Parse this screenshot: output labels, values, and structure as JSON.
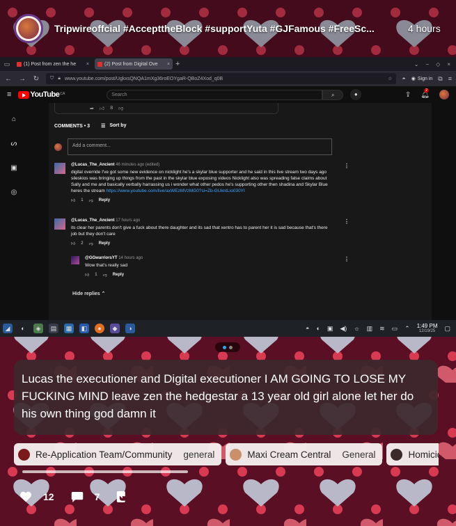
{
  "post": {
    "author_title": "Tripwireoffcial #AccepttheBlock #supportYuta #GJFamous #FreeSc...",
    "time": "4 hours"
  },
  "browser": {
    "tabs": [
      {
        "label": "(1) Post from zen the he",
        "active": false
      },
      {
        "label": "(2) Post from Digital Ove",
        "active": true
      }
    ],
    "url": "www.youtube.com/post/UgkxsQNQA1mXg36roEOYgaR-QBoZ4Xod_q0B",
    "sign_in": "Sign in"
  },
  "youtube": {
    "logo": "YouTube",
    "logo_region": "CA",
    "search_placeholder": "Search",
    "notif_count": "2",
    "prev_likes": "8",
    "comments_header": "COMMENTS • 3",
    "sort_label": "Sort by",
    "add_comment_placeholder": "Add a comment...",
    "comments": [
      {
        "handle": "@Lucas_The_Ancient",
        "meta": "46 minutes ago (edited)",
        "lines": [
          "digital override I've got some new evidence on nicklight he's a skylar blue supporter and he said in this live stream two days ago",
          "sileskios was bringing up things from the past in the skylar blue exposing videos Nicklight also was spreading false claims about",
          "Sally and me and basically verbally harrassing us i wonder what other pedos he's supporting other then shadina and Skylar Blue",
          "heres the stream"
        ],
        "link": "https://www.youtube.com/live/axWEzMVzMG0?si=Zb-GUkntLio030YI",
        "likes": "1",
        "reply": "Reply"
      },
      {
        "handle": "@Lucas_The_Ancient",
        "meta": "17 hours ago",
        "lines": [
          "its clear her parents don't give a fuck about there daughter and its sad that xentro has to parent her it is sad because that's there",
          "job but they don't care"
        ],
        "likes": "2",
        "reply": "Reply"
      },
      {
        "handle": "@GGwarriorsYT",
        "meta": "14 hours ago",
        "lines": [
          "Wow that's really sad"
        ],
        "likes": "1",
        "reply": "Reply"
      }
    ],
    "hide_replies": "Hide replies"
  },
  "taskbar": {
    "time": "1:49 PM",
    "date": "12/19/25"
  },
  "caption": "Lucas the executioner and Digital executioner I AM GOING TO LOSE MY FUCKING MIND leave zen the hedgestar a 13 year old girl alone let her do his own thing god damn it",
  "chips": [
    {
      "name": "Re-Application Team/Community",
      "channel": "general",
      "icon_color": "#7a1a1a"
    },
    {
      "name": "Maxi Cream Central",
      "channel": "General",
      "icon_color": "#c9906a"
    },
    {
      "name": "Homicide I",
      "channel": "",
      "icon_color": "#3a2a2a"
    }
  ],
  "footer": {
    "likes": "12",
    "comments": "7"
  }
}
